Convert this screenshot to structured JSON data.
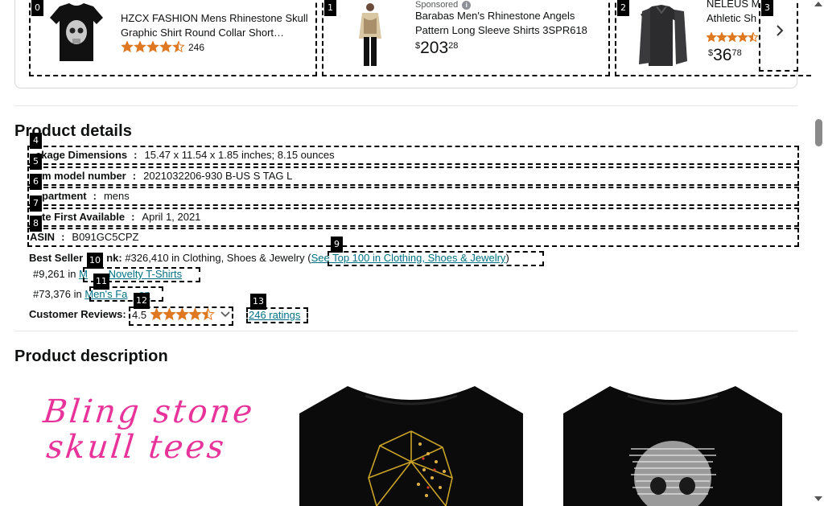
{
  "carousel": {
    "items": [
      {
        "badge": "0",
        "title_line1": "HZCX FASHION Mens Rhinestone Skull",
        "title_line2": "Graphic Shirt Round Collar Short…",
        "rating": 4.5,
        "rating_count": "246"
      },
      {
        "badge": "1",
        "sponsored": "Sponsored",
        "title_line1": "Barabas Men's Rhinestone Angels",
        "title_line2": "Pattern Long Sleeve Shirts 3SPR618",
        "price_symbol": "$",
        "price_whole": "203",
        "price_fraction": "28"
      },
      {
        "badge": "2",
        "title_line1": "NELEUS Me",
        "title_line2": "Athletic Sh",
        "rating": 4.5,
        "price_symbol": "$",
        "price_whole": "36",
        "price_fraction": "78"
      }
    ],
    "next_badge": "3"
  },
  "details": {
    "heading": "Product details",
    "rows": [
      {
        "badge": "4",
        "label": "Package Dimensions",
        "visible_label": "ckage Dimensions",
        "value": "15.47 x 11.54 x 1.85 inches; 8.15 ounces"
      },
      {
        "badge": "5",
        "label": "Item model number",
        "visible_label": "m model number",
        "value": "2021032206-930 B-US S TAG L"
      },
      {
        "badge": "6",
        "label": "Department",
        "visible_label": "partment",
        "value": "mens"
      },
      {
        "badge": "7",
        "label": "Date First Available",
        "visible_label": "te First Available",
        "value": "April 1, 2021"
      },
      {
        "badge": "8",
        "label": "ASIN",
        "visible_label": "ASIN",
        "value": "B091GC5CPZ"
      }
    ],
    "separator": ":",
    "best_sellers": {
      "label": "Best Sellers Rank:",
      "visible_label_left": "Best Seller",
      "visible_label_right": "nk:",
      "main_rank": "#326,410 in Clothing, Shoes & Jewelry (",
      "main_link": "See Top 100 in Clothing, Shoes & Jewelry",
      "main_close": ")",
      "main_link_badge": "9",
      "sub_ranks": [
        {
          "rank": "#9,261 in ",
          "link": "Men's Novelty T-Shirts",
          "visible_link_left": "M",
          "visible_link_right": " Novelty T-Shirts",
          "badge": "10"
        },
        {
          "rank": "#73,376 in ",
          "link": "Men's Fashion",
          "visible_link_left": "Men's Fa",
          "visible_link_right": "on",
          "badge": "11"
        }
      ]
    },
    "reviews": {
      "label": "Customer Reviews:",
      "rating_value": "4.5",
      "rating": 4.5,
      "rating_badge": "12",
      "ratings_link": "246 ratings",
      "ratings_badge": "13"
    }
  },
  "description": {
    "heading": "Product description",
    "banner_text_line1": "Bling stone",
    "banner_text_line2": "skull tees"
  },
  "colors": {
    "star": "#de7921",
    "link": "#007185",
    "banner_pink": "#e8339a"
  }
}
